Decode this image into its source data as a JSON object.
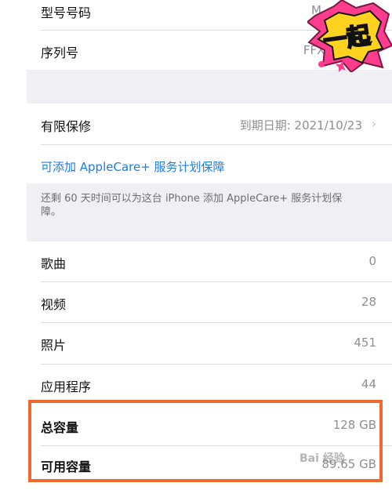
{
  "device_info": {
    "model_label": "型号号码",
    "model_value": "M",
    "serial_label": "序列号",
    "serial_value": "FFXD"
  },
  "warranty": {
    "label": "有限保修",
    "value": "到期日期: 2021/10/23"
  },
  "applecare": {
    "link_text": "可添加 AppleCare+ 服务计划保障",
    "footer_note": "还剩 60 天时间可以为这台 iPhone 添加 AppleCare+ 服务计划保障。"
  },
  "media": [
    {
      "label": "歌曲",
      "value": "0"
    },
    {
      "label": "视频",
      "value": "28"
    },
    {
      "label": "照片",
      "value": "451"
    },
    {
      "label": "应用程序",
      "value": "44"
    }
  ],
  "capacity": [
    {
      "label": "总容量",
      "value": "128 GB"
    },
    {
      "label": "可用容量",
      "value": "89.65 GB"
    }
  ],
  "overlays": {
    "sticker_text": "一起",
    "watermark_text": "Bai 经验"
  },
  "colors": {
    "link": "#1a7ee6",
    "highlight": "#f06a2e",
    "group_background": "#efeff4",
    "secondary_text": "#8e8e93"
  }
}
